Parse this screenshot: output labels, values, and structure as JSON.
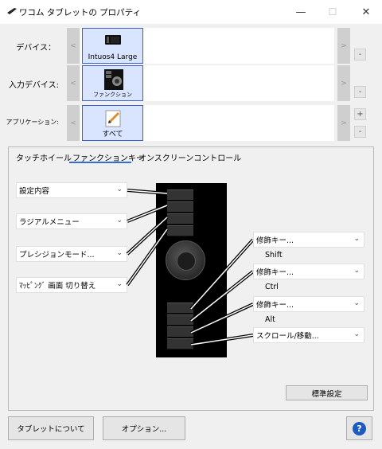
{
  "window": {
    "title": "ワコム タブレットの プロパティ",
    "minimize_glyph": "—",
    "maximize_glyph": "☐",
    "close_glyph": "✕"
  },
  "rows": {
    "device": {
      "label": "デバイス：",
      "tile_label": "Intuos4 Large"
    },
    "input": {
      "label": "入力デバイス:",
      "tile_label": "ファンクション"
    },
    "app": {
      "label": "アプリケーション:",
      "tile_label": "すべて"
    }
  },
  "nav": {
    "left": "<",
    "right": ">",
    "plus": "+",
    "minus": "-"
  },
  "tabs": [
    "タッチホイール",
    "ファンクションキー",
    "オンスクリーンコントロール"
  ],
  "active_tab": 1,
  "left_dropdowns": [
    "設定内容",
    "ラジアルメニュー",
    "プレシジョンモード...",
    "ﾏｯﾋﾟﾝｸﾞ 画面 切り替え"
  ],
  "right_dropdowns": [
    {
      "value": "修飾キー...",
      "sub": "Shift"
    },
    {
      "value": "修飾キー...",
      "sub": "Ctrl"
    },
    {
      "value": "修飾キー...",
      "sub": "Alt"
    },
    {
      "value": "スクロール/移動...",
      "sub": ""
    }
  ],
  "buttons": {
    "default": "標準設定",
    "about": "タブレットについて",
    "options": "オプション...",
    "help": "?"
  },
  "icons": {
    "app": "tablet-pen-icon",
    "chevron": "chevron-down-icon",
    "help": "help-icon"
  },
  "colors": {
    "accent": "#2f6fd0",
    "tile_bg": "#d9e4ff",
    "tile_border": "#3a5fd0",
    "help_blue": "#1e5bbf"
  }
}
